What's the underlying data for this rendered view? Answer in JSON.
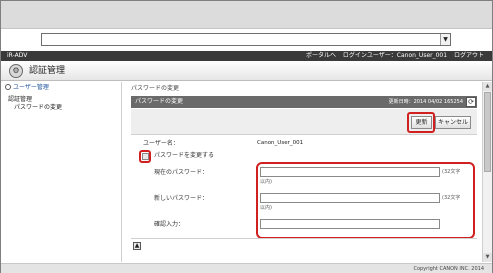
{
  "nav": {
    "model": "iR-ADV",
    "portal_link": "ポータルへ",
    "login_user_label": "ログインユーザー：Canon_User_001",
    "logout_link": "ログアウト"
  },
  "title": "認証管理",
  "sidebar": {
    "user_management": "ユーザー管理",
    "section_heading": "認証管理",
    "section_item": "パスワードの変更"
  },
  "main": {
    "breadcrumb": "パスワードの変更",
    "panel_title": "パスワードの変更",
    "updated_at": "更新日時：2014 04/02 165254",
    "update_button": "更新",
    "cancel_button": "キャンセル",
    "username_label": "ユーザー名：",
    "username_value": "Canon_User_001",
    "change_password_label": "パスワードを変更する",
    "current_password_label": "現在のパスワード：",
    "new_password_label": "新しいパスワード：",
    "confirm_label": "確認入力：",
    "max_chars_note": "(32文字",
    "ascii_note": "以内)",
    "current_password_value": "",
    "new_password_value": "",
    "confirm_value": ""
  },
  "footer": {
    "copyright": "Copyright CANON INC. 2014"
  },
  "colors": {
    "nav_bg": "#3a3a3a",
    "panel_head_bg": "#6a6a6a",
    "highlight": "#d02020",
    "link": "#1a4f9a"
  }
}
